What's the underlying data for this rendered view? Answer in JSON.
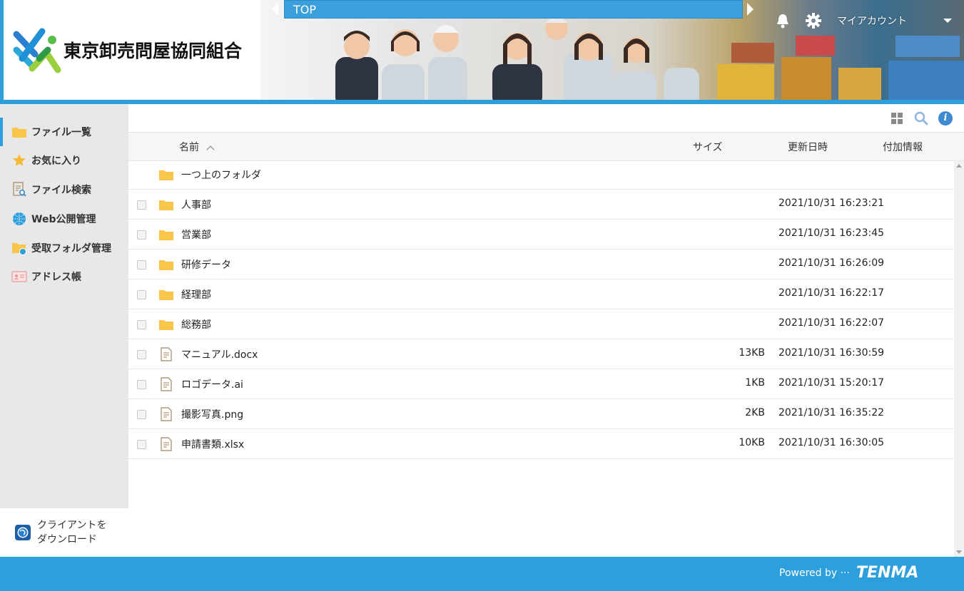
{
  "header": {
    "org_name": "東京卸売問屋協同組合",
    "breadcrumb": "TOP",
    "account_label": "マイアカウント",
    "icons": [
      "notification-bell-icon",
      "settings-gear-icon"
    ]
  },
  "sidebar": {
    "items": [
      {
        "label": "ファイル一覧",
        "icon": "folder-icon",
        "active": true
      },
      {
        "label": "お気に入り",
        "icon": "star-icon",
        "active": false
      },
      {
        "label": "ファイル検索",
        "icon": "file-search-icon",
        "active": false
      },
      {
        "label": "Web公開管理",
        "icon": "globe-icon",
        "active": false
      },
      {
        "label": "受取フォルダ管理",
        "icon": "folder-globe-icon",
        "active": false
      },
      {
        "label": "アドレス帳",
        "icon": "address-card-icon",
        "active": false
      }
    ],
    "download_label": "クライアントを\nダウンロード"
  },
  "table": {
    "headers": {
      "name": "名前",
      "size": "サイズ",
      "updated": "更新日時",
      "info": "付加情報"
    },
    "parent_folder": "一つ上のフォルダ",
    "rows": [
      {
        "name": "人事部",
        "type": "folder",
        "size": "",
        "updated": "2021/10/31 16:23:21"
      },
      {
        "name": "営業部",
        "type": "folder",
        "size": "",
        "updated": "2021/10/31 16:23:45"
      },
      {
        "name": "研修データ",
        "type": "folder",
        "size": "",
        "updated": "2021/10/31 16:26:09"
      },
      {
        "name": "経理部",
        "type": "folder",
        "size": "",
        "updated": "2021/10/31 16:22:17"
      },
      {
        "name": "総務部",
        "type": "folder",
        "size": "",
        "updated": "2021/10/31 16:22:07"
      },
      {
        "name": "マニュアル.docx",
        "type": "file",
        "size": "13KB",
        "updated": "2021/10/31 16:30:59"
      },
      {
        "name": "ロゴデータ.ai",
        "type": "file",
        "size": "1KB",
        "updated": "2021/10/31 15:20:17"
      },
      {
        "name": "撮影写真.png",
        "type": "file",
        "size": "2KB",
        "updated": "2021/10/31 16:35:22"
      },
      {
        "name": "申請書類.xlsx",
        "type": "file",
        "size": "10KB",
        "updated": "2021/10/31 16:30:05"
      }
    ]
  },
  "footer": {
    "powered_by": "Powered by ···",
    "brand": "TENMA"
  },
  "colors": {
    "accent": "#2d9fdc",
    "folder": "#f9c54a",
    "sidebar_bg": "#e8e8e8"
  }
}
